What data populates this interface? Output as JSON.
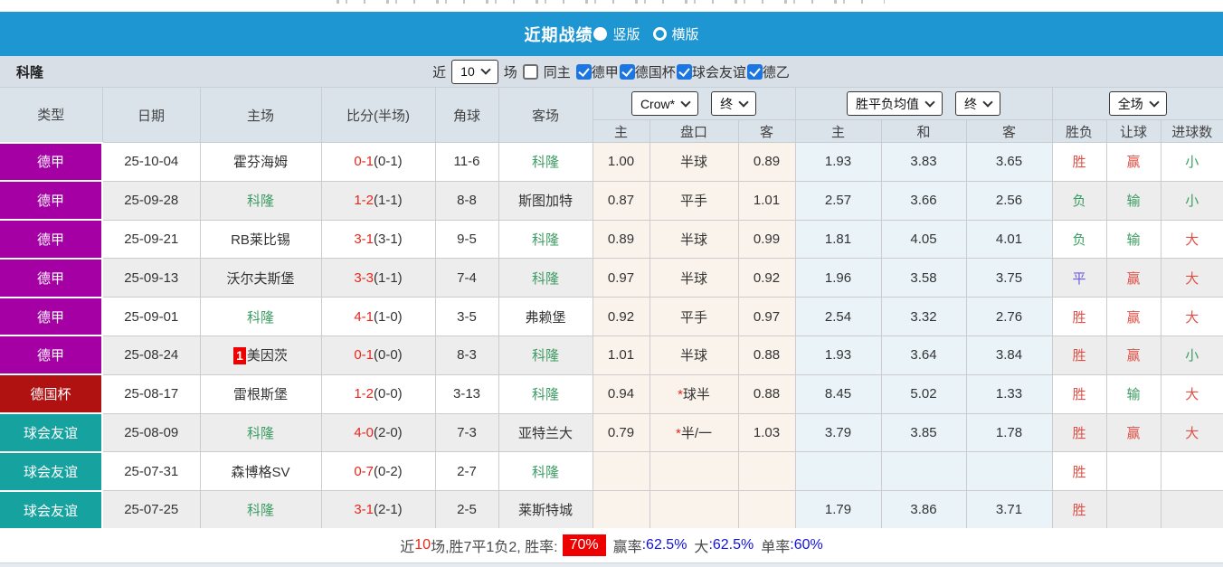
{
  "title_bar": {
    "title": "近期战绩",
    "vertical_label": "竖版",
    "horizontal_label": "横版",
    "bg_color": "#1e96d2"
  },
  "filter_bar": {
    "team_name": "科隆",
    "recent_label": "近",
    "recent_count": "10",
    "matches_label": "场",
    "same_home_label": "同主",
    "league_checkboxes": [
      {
        "label": "德甲",
        "checked": true
      },
      {
        "label": "德国杯",
        "checked": true
      },
      {
        "label": "球会友谊",
        "checked": true
      },
      {
        "label": "德乙",
        "checked": true
      }
    ]
  },
  "table": {
    "selects": {
      "ah_company": "Crow*",
      "ah_time": "终",
      "odds_type": "胜平负均值",
      "odds_time": "终",
      "scope": "全场"
    },
    "main_headers": [
      "类型",
      "日期",
      "主场",
      "比分(半场)",
      "角球",
      "客场"
    ],
    "sub_headers": [
      "主",
      "盘口",
      "客",
      "主",
      "和",
      "客",
      "胜负",
      "让球",
      "进球数"
    ],
    "league_colors": {
      "德甲": "#a400a4",
      "德国杯": "#b01111",
      "球会友谊": "#16a3a0"
    },
    "result_colors": {
      "red": "#df5146",
      "green": "#3d9c63",
      "violet": "#6a5ae0"
    },
    "rows": [
      {
        "league": "德甲",
        "date": "25-10-04",
        "home": "霍芬海姆",
        "home_hl": false,
        "score": "0-1",
        "half": "(0-1)",
        "corners": "11-6",
        "away": "科隆",
        "away_hl": true,
        "ah": [
          "1.00",
          "半球",
          "0.89"
        ],
        "ah_star": "",
        "odds": [
          "1.93",
          "3.83",
          "3.65"
        ],
        "result": "胜",
        "result_c": "red",
        "hcp": "赢",
        "hcp_c": "red",
        "goal": "小",
        "goal_c": "green"
      },
      {
        "league": "德甲",
        "date": "25-09-28",
        "home": "科隆",
        "home_hl": true,
        "score": "1-2",
        "half": "(1-1)",
        "corners": "8-8",
        "away": "斯图加特",
        "away_hl": false,
        "ah": [
          "0.87",
          "平手",
          "1.01"
        ],
        "ah_star": "",
        "odds": [
          "2.57",
          "3.66",
          "2.56"
        ],
        "result": "负",
        "result_c": "green",
        "hcp": "输",
        "hcp_c": "green",
        "goal": "小",
        "goal_c": "green"
      },
      {
        "league": "德甲",
        "date": "25-09-21",
        "home": "RB莱比锡",
        "home_hl": false,
        "score": "3-1",
        "half": "(3-1)",
        "corners": "9-5",
        "away": "科隆",
        "away_hl": true,
        "ah": [
          "0.89",
          "半球",
          "0.99"
        ],
        "ah_star": "",
        "odds": [
          "1.81",
          "4.05",
          "4.01"
        ],
        "result": "负",
        "result_c": "green",
        "hcp": "输",
        "hcp_c": "green",
        "goal": "大",
        "goal_c": "red"
      },
      {
        "league": "德甲",
        "date": "25-09-13",
        "home": "沃尔夫斯堡",
        "home_hl": false,
        "score": "3-3",
        "half": "(1-1)",
        "corners": "7-4",
        "away": "科隆",
        "away_hl": true,
        "ah": [
          "0.97",
          "半球",
          "0.92"
        ],
        "ah_star": "",
        "odds": [
          "1.96",
          "3.58",
          "3.75"
        ],
        "result": "平",
        "result_c": "violet",
        "hcp": "赢",
        "hcp_c": "red",
        "goal": "大",
        "goal_c": "red"
      },
      {
        "league": "德甲",
        "date": "25-09-01",
        "home": "科隆",
        "home_hl": true,
        "score": "4-1",
        "half": "(1-0)",
        "corners": "3-5",
        "away": "弗赖堡",
        "away_hl": false,
        "ah": [
          "0.92",
          "平手",
          "0.97"
        ],
        "ah_star": "",
        "odds": [
          "2.54",
          "3.32",
          "2.76"
        ],
        "result": "胜",
        "result_c": "red",
        "hcp": "赢",
        "hcp_c": "red",
        "goal": "大",
        "goal_c": "red"
      },
      {
        "league": "德甲",
        "date": "25-08-24",
        "home": "美因茨",
        "home_hl": false,
        "home_badge": "1",
        "score": "0-1",
        "half": "(0-0)",
        "corners": "8-3",
        "away": "科隆",
        "away_hl": true,
        "ah": [
          "1.01",
          "半球",
          "0.88"
        ],
        "ah_star": "",
        "odds": [
          "1.93",
          "3.64",
          "3.84"
        ],
        "result": "胜",
        "result_c": "red",
        "hcp": "赢",
        "hcp_c": "red",
        "goal": "小",
        "goal_c": "green"
      },
      {
        "league": "德国杯",
        "date": "25-08-17",
        "home": "雷根斯堡",
        "home_hl": false,
        "score": "1-2",
        "half": "(0-0)",
        "corners": "3-13",
        "away": "科隆",
        "away_hl": true,
        "ah": [
          "0.94",
          "球半",
          "0.88"
        ],
        "ah_star": "*",
        "odds": [
          "8.45",
          "5.02",
          "1.33"
        ],
        "result": "胜",
        "result_c": "red",
        "hcp": "输",
        "hcp_c": "green",
        "goal": "大",
        "goal_c": "red"
      },
      {
        "league": "球会友谊",
        "date": "25-08-09",
        "home": "科隆",
        "home_hl": true,
        "score": "4-0",
        "half": "(2-0)",
        "corners": "7-3",
        "away": "亚特兰大",
        "away_hl": false,
        "ah": [
          "0.79",
          "半/一",
          "1.03"
        ],
        "ah_star": "*",
        "odds": [
          "3.79",
          "3.85",
          "1.78"
        ],
        "result": "胜",
        "result_c": "red",
        "hcp": "赢",
        "hcp_c": "red",
        "goal": "大",
        "goal_c": "red"
      },
      {
        "league": "球会友谊",
        "date": "25-07-31",
        "home": "森博格SV",
        "home_hl": false,
        "score": "0-7",
        "half": "(0-2)",
        "corners": "2-7",
        "away": "科隆",
        "away_hl": true,
        "ah": [
          "",
          "",
          ""
        ],
        "ah_star": "",
        "odds": [
          "",
          "",
          ""
        ],
        "result": "胜",
        "result_c": "red",
        "hcp": "",
        "hcp_c": "",
        "goal": "",
        "goal_c": ""
      },
      {
        "league": "球会友谊",
        "date": "25-07-25",
        "home": "科隆",
        "home_hl": true,
        "score": "3-1",
        "half": "(2-1)",
        "corners": "2-5",
        "away": "莱斯特城",
        "away_hl": false,
        "ah": [
          "",
          "",
          ""
        ],
        "ah_star": "",
        "odds": [
          "1.79",
          "3.86",
          "3.71"
        ],
        "result": "胜",
        "result_c": "red",
        "hcp": "",
        "hcp_c": "",
        "goal": "",
        "goal_c": ""
      }
    ]
  },
  "summary": {
    "recent_label": "近",
    "recent_count": "10",
    "record_text": "场,胜7平1负2, 胜率:",
    "win_rate": "70%",
    "handicap_label": "赢率",
    "handicap_value": ":62.5%",
    "big_label": "大",
    "big_value": ":62.5%",
    "single_label": "单率",
    "single_value": ":60%"
  }
}
